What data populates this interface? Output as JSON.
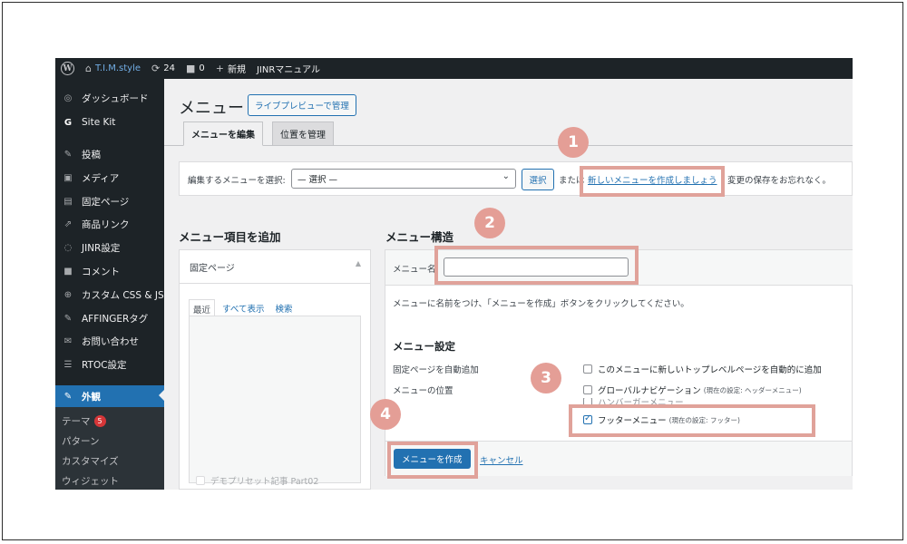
{
  "admin_bar": {
    "site_name": "T.I.M.style",
    "updates_count": "24",
    "comments_count": "0",
    "new_label": "新規",
    "manual_label": "JINRマニュアル"
  },
  "sidebar": {
    "items": [
      {
        "label": "ダッシュボード",
        "icon": "dashboard-icon",
        "glyph": "◎"
      },
      {
        "label": "Site Kit",
        "icon": "sitekit-icon",
        "glyph": "G"
      },
      {
        "label": "投稿",
        "icon": "pin-icon",
        "glyph": "✎"
      },
      {
        "label": "メディア",
        "icon": "media-icon",
        "glyph": "▣"
      },
      {
        "label": "固定ページ",
        "icon": "page-icon",
        "glyph": "▤"
      },
      {
        "label": "商品リンク",
        "icon": "link-icon",
        "glyph": "⇗"
      },
      {
        "label": "JINR設定",
        "icon": "jinr-icon",
        "glyph": "◌"
      },
      {
        "label": "コメント",
        "icon": "comment-icon",
        "glyph": "■"
      },
      {
        "label": "カスタム CSS & JS",
        "icon": "plus-circle-icon",
        "glyph": "⊕"
      },
      {
        "label": "AFFINGERタグ",
        "icon": "tag-icon",
        "glyph": "✎"
      },
      {
        "label": "お問い合わせ",
        "icon": "mail-icon",
        "glyph": "✉"
      },
      {
        "label": "RTOC設定",
        "icon": "list-icon",
        "glyph": "☰"
      },
      {
        "label": "外観",
        "icon": "appearance-icon",
        "glyph": "✎"
      }
    ],
    "submenu": [
      {
        "label": "テーマ",
        "badge": "5"
      },
      {
        "label": "パターン"
      },
      {
        "label": "カスタマイズ"
      },
      {
        "label": "ウィジェット"
      }
    ]
  },
  "page": {
    "title": "メニュー",
    "live_preview_button": "ライブプレビューで管理",
    "tabs": [
      "メニューを編集",
      "位置を管理"
    ]
  },
  "selector": {
    "label": "編集するメニューを選択:",
    "select_value": "— 選択 —",
    "select_button": "選択",
    "or_text": "または",
    "create_link": "新しいメニューを作成しましょう",
    "save_note": "変更の保存をお忘れなく。"
  },
  "left": {
    "heading": "メニュー項目を追加",
    "panel_title": "固定ページ",
    "subtabs": [
      "最近",
      "すべて表示",
      "検索"
    ],
    "item": "デモプリセット記事 Part02"
  },
  "right": {
    "heading": "メニュー構造",
    "name_label": "メニュー名",
    "name_value": "",
    "instruction": "メニューに名前をつけ、「メニューを作成」ボタンをクリックしてください。",
    "settings_heading": "メニュー設定",
    "auto_add_label": "固定ページを自動追加",
    "auto_add_option": "このメニューに新しいトップレベルページを自動的に追加",
    "location_label": "メニューの位置",
    "locations": [
      {
        "label": "グローバルナビゲーション",
        "note": "(現在の設定: ヘッダーメニュー)",
        "checked": false
      },
      {
        "label": "ハンバーガーメニュー",
        "note": "",
        "checked": false
      },
      {
        "label": "フッターメニュー",
        "note": "(現在の設定: フッター)",
        "checked": true
      }
    ],
    "create_button": "メニューを作成",
    "cancel_link": "キャンセル"
  },
  "annotations": [
    "1",
    "2",
    "3",
    "4"
  ],
  "colors": {
    "admin_dark": "#1d2327",
    "accent_blue": "#2271b1",
    "highlight": "#e0a29a",
    "badge_red": "#d63638"
  }
}
